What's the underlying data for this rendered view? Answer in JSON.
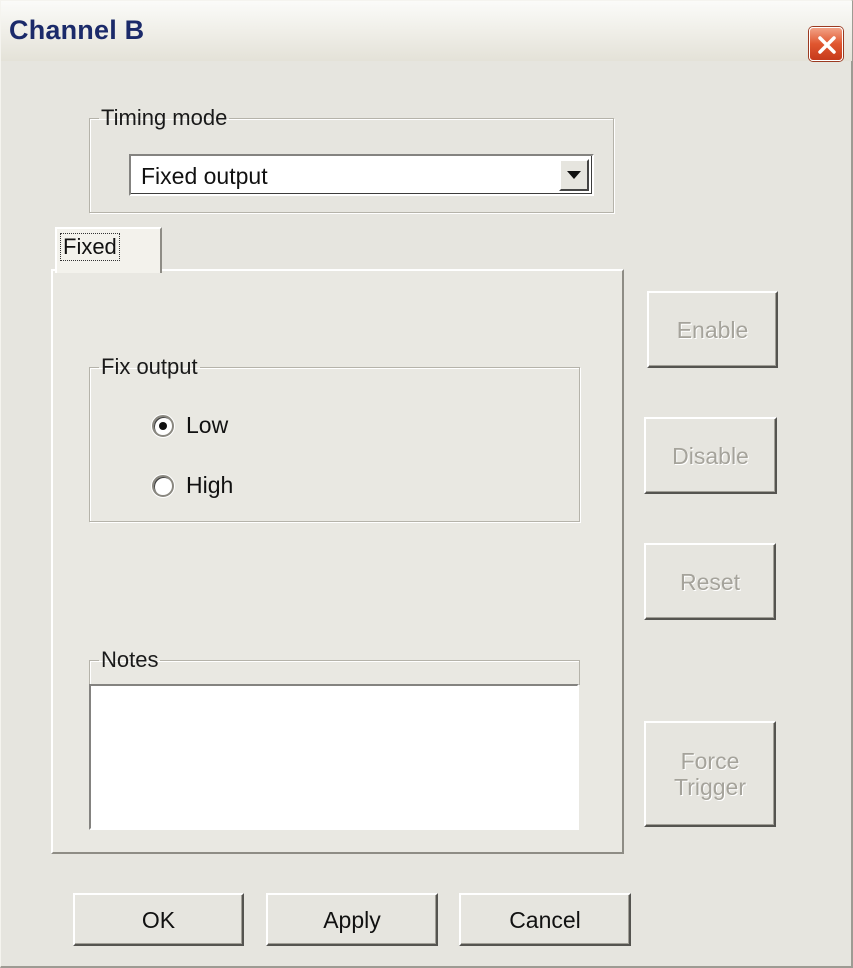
{
  "window": {
    "title": "Channel B",
    "close_label": "close"
  },
  "timing_mode": {
    "legend": "Timing mode",
    "selected": "Fixed output"
  },
  "tabs": [
    {
      "label": "Fixed",
      "active": true
    }
  ],
  "fix_output": {
    "legend": "Fix output",
    "options": [
      {
        "label": "Low",
        "checked": true
      },
      {
        "label": "High",
        "checked": false
      }
    ]
  },
  "notes": {
    "legend": "Notes",
    "value": ""
  },
  "side_buttons": {
    "enable": "Enable",
    "disable": "Disable",
    "reset": "Reset",
    "force_trigger_line1": "Force",
    "force_trigger_line2": "Trigger"
  },
  "footer_buttons": {
    "ok": "OK",
    "apply": "Apply",
    "cancel": "Cancel"
  },
  "icons": {
    "close": "close-x-icon",
    "dropdown": "triangle-down-icon"
  },
  "colors": {
    "title_text": "#1b2a6a",
    "close_button": "#e0562f",
    "dialog_face": "#e6e5df",
    "disabled_text": "#a5a39b"
  }
}
